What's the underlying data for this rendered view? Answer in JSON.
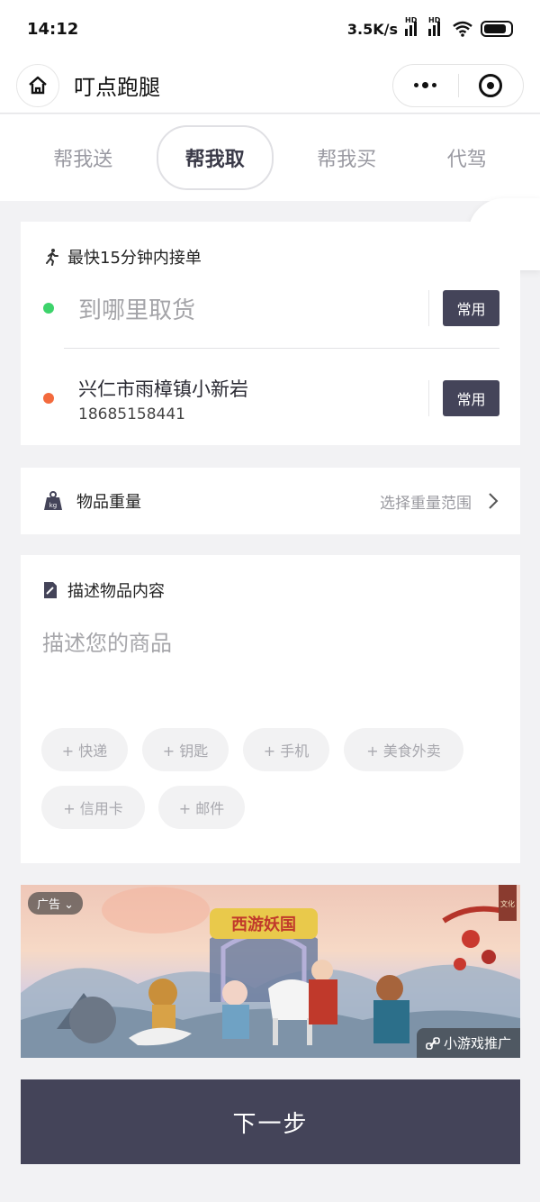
{
  "status_bar": {
    "time": "14:12",
    "net_speed": "3.5K/s",
    "hd_label": "HD"
  },
  "nav": {
    "title": "叮点跑腿"
  },
  "tabs": [
    {
      "label": "帮我送",
      "active": false
    },
    {
      "label": "帮我取",
      "active": true
    },
    {
      "label": "帮我买",
      "active": false
    },
    {
      "label": "代驾",
      "active": false
    }
  ],
  "pickup": {
    "hint": "最快15分钟内接单",
    "from_placeholder": "到哪里取货",
    "from_button": "常用",
    "to_address": "兴仁市雨樟镇小新岩",
    "to_phone": "18685158441",
    "to_button": "常用"
  },
  "weight": {
    "label": "物品重量",
    "value": "选择重量范围",
    "icon_text": "kg"
  },
  "describe": {
    "title": "描述物品内容",
    "placeholder": "描述您的商品",
    "tags": [
      "+ 快递",
      "+ 钥匙",
      "+ 手机",
      "+ 美食外卖",
      "+ 信用卡",
      "+ 邮件"
    ]
  },
  "ad": {
    "badge": "广告",
    "promo": "小游戏推广",
    "game_title": "西游妖国",
    "corner_seal": "文化"
  },
  "next_button": "下一步",
  "colors": {
    "primary_dark": "#444459",
    "green_dot": "#3dd36b",
    "orange_dot": "#f36a3d"
  }
}
